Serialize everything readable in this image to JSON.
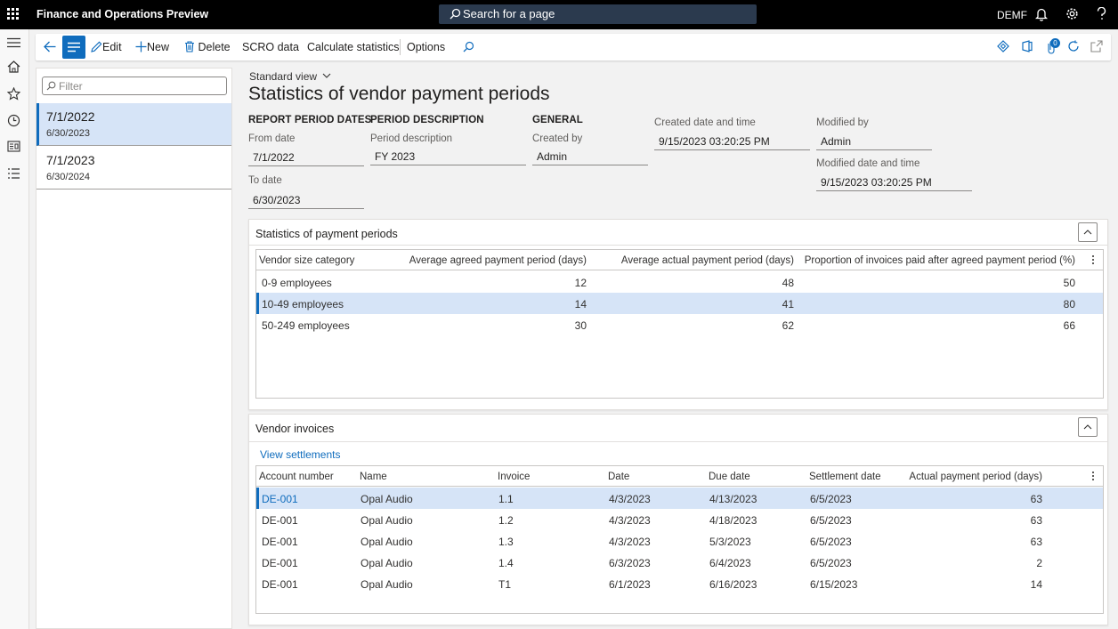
{
  "topbar": {
    "app_title": "Finance and Operations Preview",
    "search_placeholder": "Search for a page",
    "company": "DEMF"
  },
  "actions": {
    "edit": "Edit",
    "new": "New",
    "delete": "Delete",
    "scro_data": "SCRO data",
    "calculate_statistics": "Calculate statistics",
    "options": "Options",
    "notification_count": "0"
  },
  "list": {
    "filter_placeholder": "Filter",
    "items": [
      {
        "main": "7/1/2022",
        "sub": "6/30/2023",
        "selected": true
      },
      {
        "main": "7/1/2023",
        "sub": "6/30/2024",
        "selected": false
      }
    ]
  },
  "detail": {
    "view_name": "Standard view",
    "title": "Statistics of vendor payment periods",
    "report_period": {
      "heading": "REPORT PERIOD DATES",
      "from_label": "From date",
      "from_value": "7/1/2022",
      "to_label": "To date",
      "to_value": "6/30/2023"
    },
    "period_description": {
      "heading": "PERIOD DESCRIPTION",
      "label": "Period description",
      "value": "FY 2023"
    },
    "general": {
      "heading": "GENERAL",
      "created_by_label": "Created by",
      "created_by_value": "Admin",
      "created_dt_label": "Created date and time",
      "created_dt_value": "9/15/2023 03:20:25 PM",
      "modified_by_label": "Modified by",
      "modified_by_value": "Admin",
      "modified_dt_label": "Modified date and time",
      "modified_dt_value": "9/15/2023 03:20:25 PM"
    }
  },
  "stats": {
    "title": "Statistics of payment periods",
    "columns": [
      "Vendor size category",
      "Average agreed payment period (days)",
      "Average actual payment period (days)",
      "Proportion of invoices paid after agreed payment period (%)"
    ],
    "rows": [
      {
        "category": "0-9 employees",
        "agreed": "12",
        "actual": "48",
        "proportion": "50",
        "selected": false
      },
      {
        "category": "10-49 employees",
        "agreed": "14",
        "actual": "41",
        "proportion": "80",
        "selected": true
      },
      {
        "category": "50-249 employees",
        "agreed": "30",
        "actual": "62",
        "proportion": "66",
        "selected": false
      }
    ]
  },
  "invoices": {
    "title": "Vendor invoices",
    "view_settlements": "View settlements",
    "columns": [
      "Account number",
      "Name",
      "Invoice",
      "Date",
      "Due date",
      "Settlement date",
      "Actual payment period (days)"
    ],
    "rows": [
      {
        "account": "DE-001",
        "name": "Opal Audio",
        "invoice": "1.1",
        "date": "4/3/2023",
        "due": "4/13/2023",
        "settled": "6/5/2023",
        "period": "63",
        "selected": true
      },
      {
        "account": "DE-001",
        "name": "Opal Audio",
        "invoice": "1.2",
        "date": "4/3/2023",
        "due": "4/18/2023",
        "settled": "6/5/2023",
        "period": "63",
        "selected": false
      },
      {
        "account": "DE-001",
        "name": "Opal Audio",
        "invoice": "1.3",
        "date": "4/3/2023",
        "due": "5/3/2023",
        "settled": "6/5/2023",
        "period": "63",
        "selected": false
      },
      {
        "account": "DE-001",
        "name": "Opal Audio",
        "invoice": "1.4",
        "date": "6/3/2023",
        "due": "6/4/2023",
        "settled": "6/5/2023",
        "period": "2",
        "selected": false
      },
      {
        "account": "DE-001",
        "name": "Opal Audio",
        "invoice": "T1",
        "date": "6/1/2023",
        "due": "6/16/2023",
        "settled": "6/15/2023",
        "period": "14",
        "selected": false
      }
    ]
  }
}
